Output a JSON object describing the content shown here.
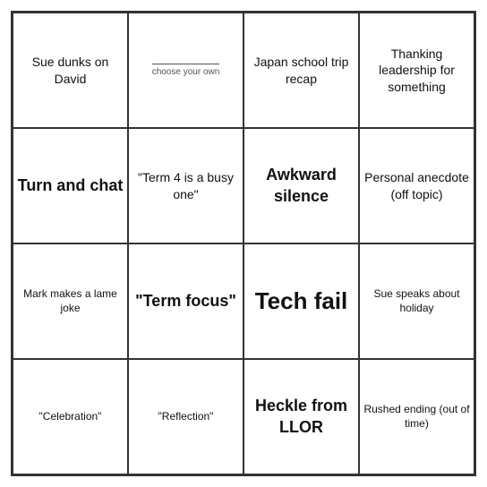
{
  "grid": {
    "cells": [
      {
        "id": "r0c0",
        "text": "Sue dunks on David",
        "size": "normal"
      },
      {
        "id": "r0c1",
        "text": "choose your own",
        "size": "choose"
      },
      {
        "id": "r0c2",
        "text": "Japan school trip recap",
        "size": "normal"
      },
      {
        "id": "r0c3",
        "text": "Thanking leadership for something",
        "size": "normal"
      },
      {
        "id": "r1c0",
        "text": "Turn and chat",
        "size": "medium"
      },
      {
        "id": "r1c1",
        "text": "\"Term 4 is a busy one\"",
        "size": "normal"
      },
      {
        "id": "r1c2",
        "text": "Awkward silence",
        "size": "normal"
      },
      {
        "id": "r1c3",
        "text": "Personal anecdote (off topic)",
        "size": "normal"
      },
      {
        "id": "r2c0",
        "text": "Mark makes a lame joke",
        "size": "small"
      },
      {
        "id": "r2c1",
        "text": "\"Term focus\"",
        "size": "medium"
      },
      {
        "id": "r2c2",
        "text": "Tech fail",
        "size": "large"
      },
      {
        "id": "r2c3",
        "text": "Sue speaks about holiday",
        "size": "small"
      },
      {
        "id": "r3c0",
        "text": "\"Celebration\"",
        "size": "small"
      },
      {
        "id": "r3c1",
        "text": "\"Reflection\"",
        "size": "small"
      },
      {
        "id": "r3c2",
        "text": "Heckle from LLOR",
        "size": "normal"
      },
      {
        "id": "r3c3",
        "text": "Rushed ending (out of time)",
        "size": "small"
      }
    ]
  }
}
